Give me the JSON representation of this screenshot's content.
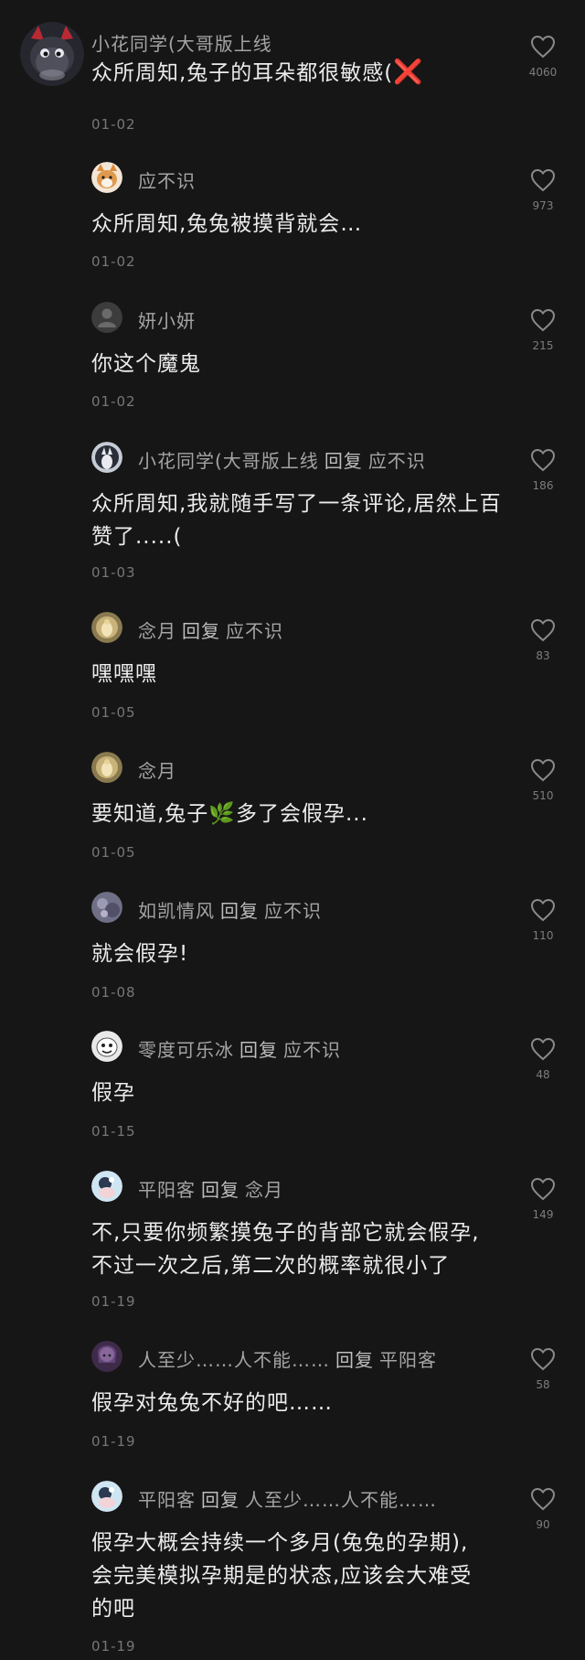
{
  "comments": [
    {
      "name": "小花同学(大哥版上线",
      "reply_word": "",
      "target": "",
      "text": "众所周知,兔子的耳朵都很敏感(",
      "emoji": "❌",
      "date": "01-02",
      "likes": "4060"
    },
    {
      "name": "应不识",
      "reply_word": "",
      "target": "",
      "text": "众所周知,兔兔被摸背就会…",
      "date": "01-02",
      "likes": "973"
    },
    {
      "name": "妍小妍",
      "reply_word": "",
      "target": "",
      "text": "你这个魔鬼",
      "date": "01-02",
      "likes": "215"
    },
    {
      "name": "小花同学(大哥版上线",
      "reply_word": "回复",
      "target": "应不识",
      "text": "众所周知,我就随手写了一条评论,居然上百赞了.....(",
      "date": "01-03",
      "likes": "186"
    },
    {
      "name": "念月",
      "reply_word": "回复",
      "target": "应不识",
      "text": "嘿嘿嘿",
      "date": "01-05",
      "likes": "83"
    },
    {
      "name": "念月",
      "reply_word": "",
      "target": "",
      "text_before": "要知道,兔子",
      "emoji": "🌿",
      "text_after": "多了会假孕...",
      "date": "01-05",
      "likes": "510"
    },
    {
      "name": "如凯情风",
      "reply_word": "回复",
      "target": "应不识",
      "text": "就会假孕!",
      "date": "01-08",
      "likes": "110"
    },
    {
      "name": "零度可乐冰",
      "reply_word": "回复",
      "target": "应不识",
      "text": "假孕",
      "date": "01-15",
      "likes": "48"
    },
    {
      "name": "平阳客",
      "reply_word": "回复",
      "target": "念月",
      "text": "不,只要你频繁摸兔子的背部它就会假孕,\n不过一次之后,第二次的概率就很小了",
      "date": "01-19",
      "likes": "149"
    },
    {
      "name": "人至少……人不能……",
      "reply_word": "回复",
      "target": "平阳客",
      "text": "假孕对兔兔不好的吧……",
      "date": "01-19",
      "likes": "58"
    },
    {
      "name": "平阳客",
      "reply_word": "回复",
      "target": "人至少……人不能……",
      "text": "假孕大概会持续一个多月(兔兔的孕期),\n会完美模拟孕期是的状态,应该会大难受\n的吧",
      "date": "01-19",
      "likes": "90"
    }
  ],
  "colors": {
    "background": "#161616",
    "text": "#ececec",
    "secondary": "#a4a4a4",
    "date": "#777777",
    "accent_x": "#e3222b"
  },
  "icons": {
    "like": "heart-outline-icon"
  }
}
